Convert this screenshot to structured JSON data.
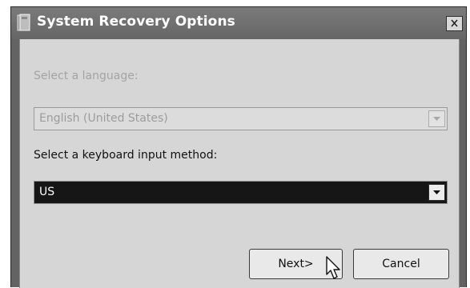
{
  "window": {
    "title": "System Recovery Options",
    "close_symbol": "×"
  },
  "language": {
    "label": "Select a language:",
    "selected": "English (United States)",
    "enabled": false
  },
  "keyboard": {
    "label": "Select a keyboard input method:",
    "selected": "US",
    "enabled": true
  },
  "buttons": {
    "next_label": "Next>",
    "cancel_label": "Cancel"
  },
  "icons": {
    "app": "recovery-window-icon",
    "close": "close-icon",
    "dropdown": "chevron-down-icon",
    "cursor": "mouse-pointer-icon"
  },
  "colors": {
    "titlebar": "#6b6b6b",
    "client": "#d6d6d6",
    "selected_field": "#161616",
    "disabled_text": "#a4a4a4"
  }
}
